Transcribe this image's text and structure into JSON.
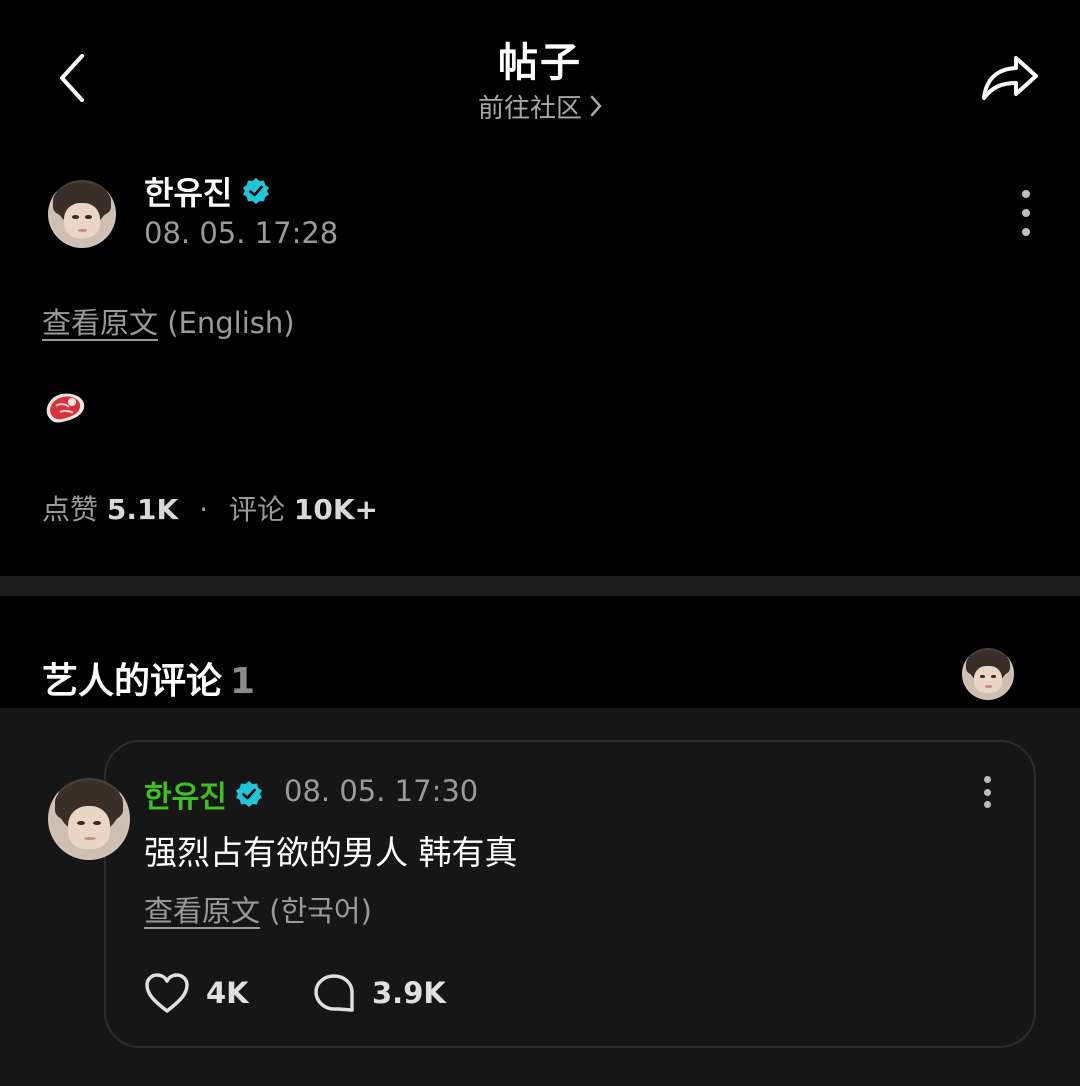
{
  "header": {
    "title": "帖子",
    "community_link": "前往社区"
  },
  "post": {
    "author": "한유진",
    "time": "08. 05. 17:28",
    "translate_link": "查看原文",
    "translate_lang": "(English)",
    "content_emoji": "steak",
    "likes_label": "点赞",
    "likes_value": "5.1K",
    "separator": "·",
    "comments_label": "评论",
    "comments_value": "10K+"
  },
  "artist_comments": {
    "title": "艺人的评论",
    "count": "1",
    "comment": {
      "author": "한유진",
      "time": "08. 05. 17:30",
      "text": "强烈占有欲的男人 韩有真",
      "translate_link": "查看原文",
      "translate_lang": "(한국어)",
      "likes": "4K",
      "replies": "3.9K"
    }
  },
  "colors": {
    "background": "#000000",
    "verified": "#1fc6d8",
    "artist_name": "#3ec01f",
    "muted_text": "#9a9a9a"
  }
}
